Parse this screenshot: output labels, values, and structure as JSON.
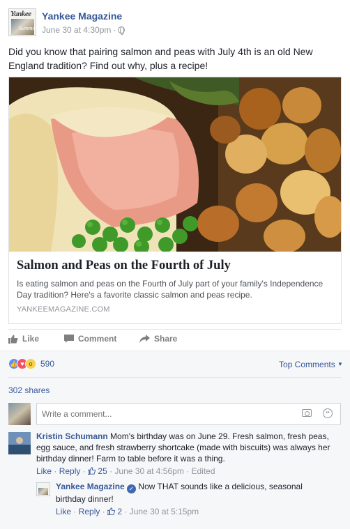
{
  "post": {
    "page_name": "Yankee Magazine",
    "avatar_masthead": "Yankee",
    "avatar_subtitle": "Summer",
    "timestamp": "June 30 at 4:30pm",
    "separator": "·",
    "privacy_icon": "globe-icon",
    "text": "Did you know that pairing salmon and peas with July 4th is an old New England tradition? Find out why, plus a recipe!"
  },
  "link_card": {
    "image_icon": "salmon-and-peas-photo",
    "title": "Salmon and Peas on the Fourth of July",
    "description": "Is eating salmon and peas on the Fourth of July part of your family's Independence Day tradition? Here's a favorite classic salmon and peas recipe.",
    "domain": "YANKEEMAGAZINE.COM"
  },
  "actions": {
    "like": "Like",
    "comment": "Comment",
    "share": "Share"
  },
  "reactions": {
    "count": "590",
    "types": [
      "like",
      "love",
      "wow"
    ],
    "top_comments": "Top Comments"
  },
  "shares": "302 shares",
  "composer": {
    "placeholder": "Write a comment..."
  },
  "comments": [
    {
      "author": "Kristin Schumann",
      "text": "Mom's birthday was on June 29. Fresh salmon, fresh peas, egg sauce, and fresh strawberry shortcake (made with biscuits) was always her birthday dinner! Farm to table before it was a thing.",
      "like": "Like",
      "reply": "Reply",
      "likes": "25",
      "time": "June 30 at 4:56pm",
      "edited": "Edited"
    }
  ],
  "reply": {
    "author": "Yankee Magazine",
    "text": "Now THAT sounds like a delicious, seasonal birthday dinner!",
    "like": "Like",
    "reply": "Reply",
    "likes": "2",
    "time": "June 30 at 5:15pm"
  },
  "colors": {
    "link_blue": "#365899",
    "meta_grey": "#90949c",
    "like_blue": "#5890ff",
    "love_red": "#f25268",
    "wow_yellow": "#f7d14a"
  }
}
